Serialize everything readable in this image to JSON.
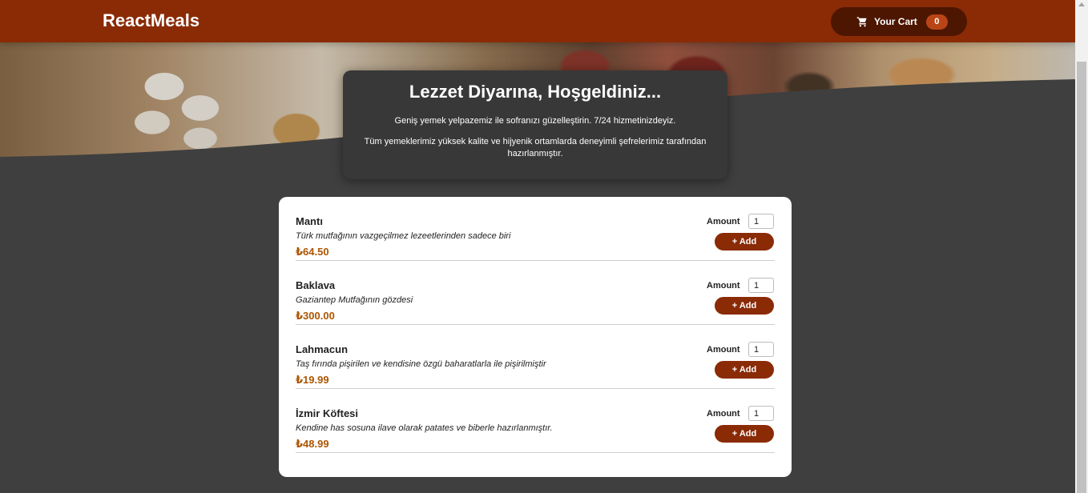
{
  "header": {
    "brand": "ReactMeals",
    "cart": {
      "label": "Your Cart",
      "count": "0",
      "icon": "cart-icon"
    }
  },
  "summary": {
    "title": "Lezzet Diyarına, Hoşgeldiniz...",
    "paragraphs": [
      "Geniş yemek yelpazemiz ile sofranızı güzelleştirin. 7/24 hizmetinizdeyiz.",
      "Tüm yemeklerimiz yüksek kalite ve hijyenik ortamlarda deneyimli şefrelerimiz tarafından hazırlanmıştır."
    ]
  },
  "meals": [
    {
      "name": "Mantı",
      "description": "Türk mutfağının vazgeçilmez lezeetlerinden sadece biri",
      "price": "₺64.50",
      "amount_label": "Amount",
      "amount": "1",
      "add_label": "+ Add"
    },
    {
      "name": "Baklava",
      "description": "Gaziantep Mutfağının gözdesi",
      "price": "₺300.00",
      "amount_label": "Amount",
      "amount": "1",
      "add_label": "+ Add"
    },
    {
      "name": "Lahmacun",
      "description": "Taş fırında pişirilen ve kendisine özgü baharatlarla ile pişirilmiştir",
      "price": "₺19.99",
      "amount_label": "Amount",
      "amount": "1",
      "add_label": "+ Add"
    },
    {
      "name": "İzmir Köftesi",
      "description": "Kendine has sosuna ilave olarak patates ve biberle hazırlanmıştır.",
      "price": "₺48.99",
      "amount_label": "Amount",
      "amount": "1",
      "add_label": "+ Add"
    }
  ],
  "colors": {
    "header": "#8a2b06",
    "cart_button": "#4d1601",
    "badge": "#b94517",
    "price": "#ad5502",
    "background": "#3f3f3f"
  }
}
